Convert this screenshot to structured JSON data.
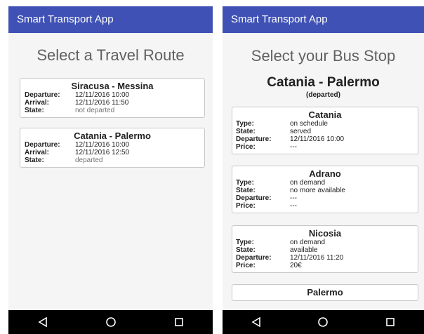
{
  "left": {
    "app_title": "Smart Transport App",
    "page_title": "Select a Travel Route",
    "routes": [
      {
        "name": "Siracusa - Messina",
        "departure_label": "Departure:",
        "departure": "12/11/2016 10:00",
        "arrival_label": "Arrival:",
        "arrival": "12/11/2016 11:50",
        "state_label": "State:",
        "state": "not departed"
      },
      {
        "name": "Catania - Palermo",
        "departure_label": "Departure:",
        "departure": "12/11/2016 10:00",
        "arrival_label": "Arrival:",
        "arrival": "12/11/2016 12:50",
        "state_label": "State:",
        "state": "departed"
      }
    ]
  },
  "right": {
    "app_title": "Smart Transport App",
    "page_title": "Select your Bus Stop",
    "route_name": "Catania - Palermo",
    "route_state": "(departed)",
    "labels": {
      "type": "Type:",
      "state": "State:",
      "departure": "Departure:",
      "price": "Price:"
    },
    "stops": [
      {
        "name": "Catania",
        "type": "on schedule",
        "state": "served",
        "departure": "12/11/2016 10:00",
        "price": "---"
      },
      {
        "name": "Adrano",
        "type": "on demand",
        "state": "no more available",
        "departure": "---",
        "price": "---"
      },
      {
        "name": "Nicosia",
        "type": "on demand",
        "state": "available",
        "departure": "12/11/2016 11:20",
        "price": "20€"
      },
      {
        "name": "Palermo"
      }
    ]
  },
  "navbar": {
    "icons": [
      "back-triangle-icon",
      "home-circle-icon",
      "recents-square-icon"
    ],
    "color": "#000000"
  },
  "colors": {
    "appbar": "#3f51b5",
    "background": "#f5f5f5",
    "card_border": "#c8c8c8"
  }
}
